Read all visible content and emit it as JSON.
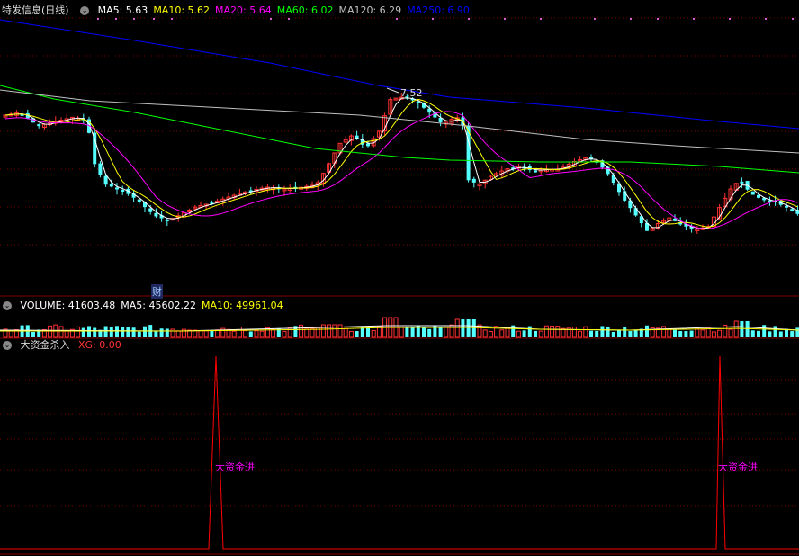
{
  "main_panel": {
    "title": "特发信息(日线)",
    "ma_labels": [
      {
        "key": "MA5",
        "text": "MA5: 5.63",
        "color": "#ffffff"
      },
      {
        "key": "MA10",
        "text": "MA10: 5.62",
        "color": "#ffff00"
      },
      {
        "key": "MA20",
        "text": "MA20: 5.64",
        "color": "#ff00ff"
      },
      {
        "key": "MA60",
        "text": "MA60: 6.02",
        "color": "#00ff00"
      },
      {
        "key": "MA120",
        "text": "MA120: 6.29",
        "color": "#c0c0c0"
      },
      {
        "key": "MA250",
        "text": "MA250: 6.90",
        "color": "#0000ff"
      }
    ],
    "high_label": "7.52",
    "finance_marker": "财"
  },
  "volume_panel": {
    "labels": [
      {
        "key": "VOLUME",
        "text": "VOLUME: 41603.48",
        "color": "#ffffff"
      },
      {
        "key": "MA5",
        "text": "MA5: 45602.22",
        "color": "#ffffff"
      },
      {
        "key": "MA10",
        "text": "MA10: 49961.04",
        "color": "#ffff00"
      }
    ]
  },
  "indicator_panel": {
    "title": "大资金杀入",
    "xg_label": "XG: 0.00",
    "signal_text": "大资金进",
    "signal_count": 2
  },
  "colors": {
    "up": "#ff3232",
    "down": "#54ffff",
    "grid": "#800000",
    "ma5": "#ffffff",
    "ma10": "#ffff00",
    "ma20": "#ff00ff",
    "ma60": "#00ff00",
    "ma120": "#c0c0c0",
    "ma250": "#0000ff",
    "signal_line": "#ff0000",
    "signal_text": "#ff00ff"
  }
}
